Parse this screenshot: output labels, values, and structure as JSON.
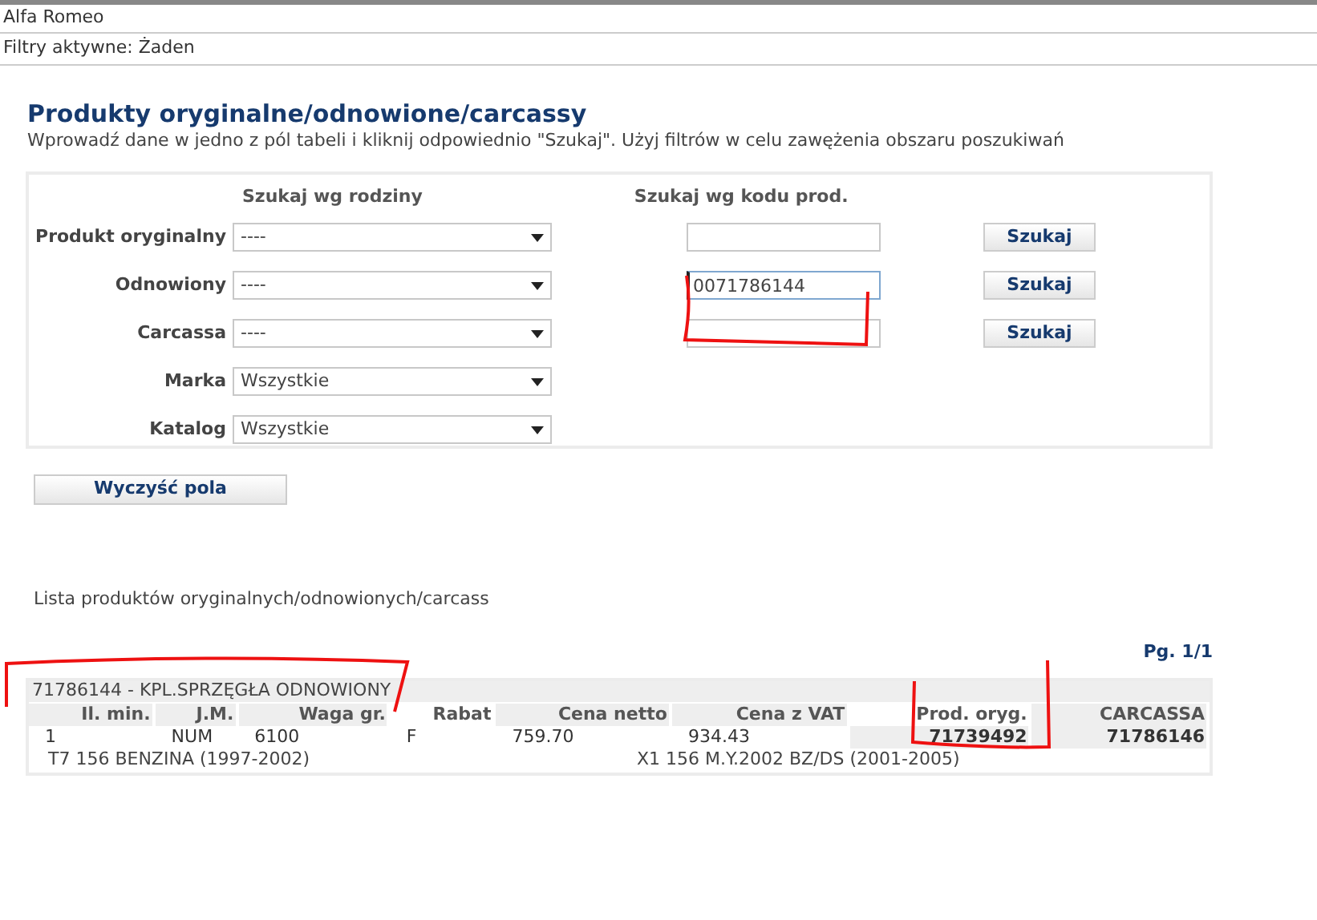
{
  "header": {
    "brand": "Alfa Romeo",
    "filters": "Filtry aktywne: Żaden"
  },
  "title": "Produkty oryginalne/odnowione/carcassy",
  "subtitle": "Wprowadź dane w jedno z pól tabeli i kliknij odpowiednio \"Szukaj\". Użyj filtrów w celu zawężenia obszaru poszukiwań",
  "form": {
    "column_headers": [
      "Szukaj wg rodziny",
      "Szukaj wg kodu prod."
    ],
    "rows": [
      {
        "label": "Produkt oryginalny",
        "select": "----",
        "code": {
          "focused": false
        },
        "button": "Szukaj"
      },
      {
        "label": "Odnowiony",
        "select": "----",
        "code": {
          "value": "0071786144",
          "focused": true
        },
        "button": "Szukaj"
      },
      {
        "label": "Carcassa",
        "select": "----",
        "code": {
          "focused": false
        },
        "button": "Szukaj"
      },
      {
        "label": "Marka",
        "select": "Wszystkie"
      },
      {
        "label": "Katalog",
        "select": "Wszystkie"
      }
    ]
  },
  "clear_button": "Wyczyść pola",
  "list_title": "Lista produktów oryginalnych/odnowionych/carcass",
  "pagination": "Pg. 1/1",
  "product": {
    "title": "71786144 - KPL.SPRZĘGŁA ODNOWIONY",
    "columns": [
      "Il. min.",
      "J.M.",
      "Waga gr.",
      "Rabat",
      "Cena netto",
      "Cena z VAT",
      "Prod. oryg.",
      "CARCASSA"
    ],
    "values": [
      "1",
      "NUM",
      "6100",
      "F",
      "759.70",
      "934.43",
      "71739492",
      "71786146"
    ],
    "models": [
      "T7 156 BENZINA (1997-2002)",
      "X1 156 M.Y.2002 BZ/DS (2001-2005)"
    ]
  }
}
